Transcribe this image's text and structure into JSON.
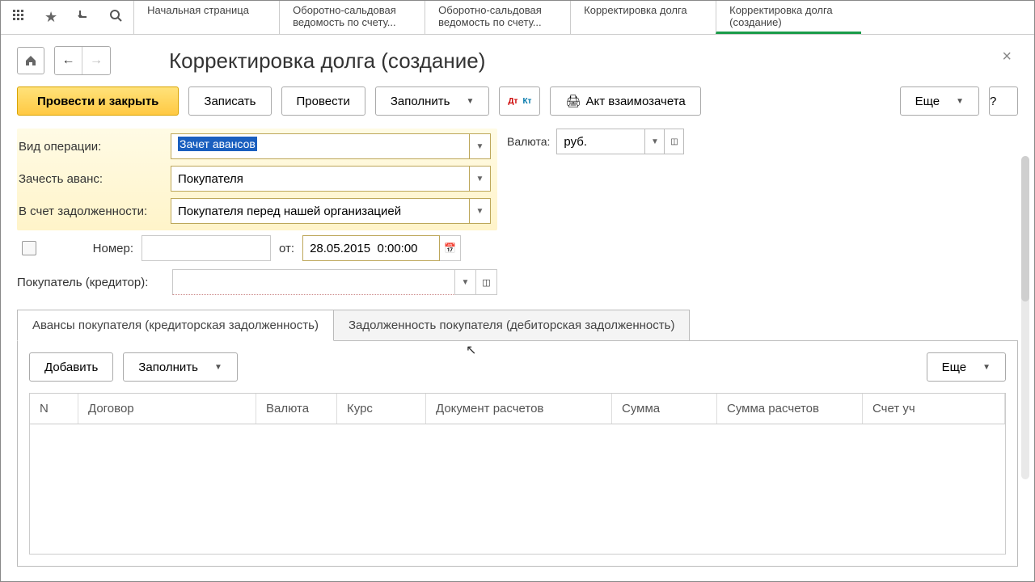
{
  "topIcons": {
    "apps": "⋮⋮⋮",
    "star": "★",
    "history": "↳",
    "search": "🔍"
  },
  "tabs": [
    {
      "l1": "Начальная страница",
      "l2": ""
    },
    {
      "l1": "Оборотно-сальдовая",
      "l2": "ведомость по счету..."
    },
    {
      "l1": "Оборотно-сальдовая",
      "l2": "ведомость по счету..."
    },
    {
      "l1": "Корректировка долга",
      "l2": ""
    },
    {
      "l1": "Корректировка долга",
      "l2": "(создание)"
    }
  ],
  "page_title": "Корректировка долга (создание)",
  "toolbar": {
    "post_close": "Провести и закрыть",
    "write": "Записать",
    "post": "Провести",
    "fill": "Заполнить",
    "dtKt": "Дт/Кт",
    "act": "Акт взаимозачета",
    "more": "Еще",
    "help": "?"
  },
  "fields": {
    "op_label": "Вид операции:",
    "op_value": "Зачет авансов",
    "adv_label": "Зачесть аванс:",
    "adv_value": "Покупателя",
    "debt_label": "В счет задолженности:",
    "debt_value": "Покупателя перед нашей организацией",
    "currency_label": "Валюта:",
    "currency_value": "руб.",
    "num_label": "Номер:",
    "from_label": "от:",
    "date_value": "28.05.2015  0:00:00",
    "buyer_label": "Покупатель (кредитор):",
    "buyer_value": ""
  },
  "doc_tabs": {
    "t1": "Авансы покупателя (кредиторская задолженность)",
    "t2": "Задолженность покупателя (дебиторская задолженность)"
  },
  "sub_toolbar": {
    "add": "Добавить",
    "fill": "Заполнить",
    "more": "Еще"
  },
  "grid_head": {
    "n": "N",
    "dog": "Договор",
    "val": "Валюта",
    "kurs": "Курс",
    "doc": "Документ расчетов",
    "sum": "Сумма",
    "sumr": "Сумма расчетов",
    "acc": "Счет уч"
  }
}
